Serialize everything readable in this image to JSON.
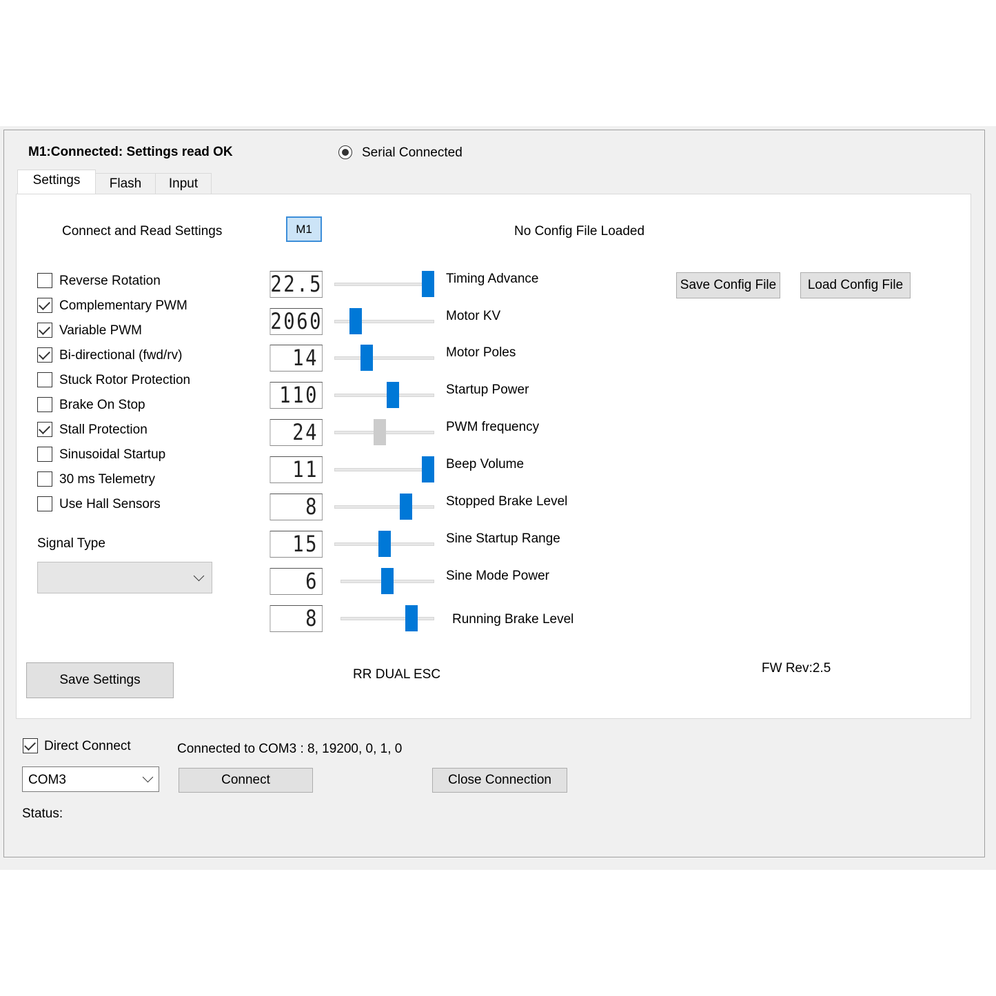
{
  "header": {
    "status_title": "M1:Connected: Settings read OK",
    "serial_radio_label": "Serial Connected"
  },
  "tabs": [
    {
      "label": "Settings",
      "active": true
    },
    {
      "label": "Flash",
      "active": false
    },
    {
      "label": "Input",
      "active": false
    }
  ],
  "settings": {
    "connect_read_label": "Connect and Read Settings",
    "m1_button": "M1",
    "config_status": "No Config File Loaded",
    "save_config_button": "Save Config File",
    "load_config_button": "Load Config File",
    "checkboxes": [
      {
        "label": "Reverse Rotation",
        "checked": false
      },
      {
        "label": "Complementary PWM",
        "checked": true
      },
      {
        "label": "Variable PWM",
        "checked": true
      },
      {
        "label": "Bi-directional (fwd/rv)",
        "checked": true
      },
      {
        "label": "Stuck Rotor Protection",
        "checked": false
      },
      {
        "label": "Brake On Stop",
        "checked": false
      },
      {
        "label": "Stall Protection",
        "checked": true
      },
      {
        "label": "Sinusoidal Startup",
        "checked": false
      },
      {
        "label": "30 ms Telemetry",
        "checked": false
      },
      {
        "label": "Use Hall Sensors",
        "checked": false
      }
    ],
    "signal_type_label": "Signal Type",
    "signal_type_value": "",
    "sliders": [
      {
        "label": "Timing Advance",
        "value": "22.5",
        "position": 1.0,
        "enabled": true
      },
      {
        "label": "Motor KV",
        "value": "2060",
        "position": 0.17,
        "enabled": true
      },
      {
        "label": "Motor Poles",
        "value": "14",
        "position": 0.3,
        "enabled": true
      },
      {
        "label": "Startup Power",
        "value": "110",
        "position": 0.6,
        "enabled": true
      },
      {
        "label": "PWM frequency",
        "value": "24",
        "position": 0.45,
        "enabled": false
      },
      {
        "label": "Beep Volume",
        "value": "11",
        "position": 1.0,
        "enabled": true
      },
      {
        "label": "Stopped Brake Level",
        "value": "8",
        "position": 0.75,
        "enabled": true
      },
      {
        "label": "Sine Startup Range",
        "value": "15",
        "position": 0.5,
        "enabled": true
      },
      {
        "label": "Sine Mode Power",
        "value": "6",
        "position": 0.5,
        "enabled": true
      },
      {
        "label": "Running Brake Level",
        "value": "8",
        "position": 0.8,
        "enabled": true
      }
    ],
    "save_settings_button": "Save Settings",
    "device_name": "RR DUAL ESC",
    "fw_rev": "FW Rev:2.5"
  },
  "connection": {
    "direct_connect_label": "Direct Connect",
    "direct_connect_checked": true,
    "connected_info": "Connected to COM3 : 8, 19200, 0, 1, 0",
    "port_value": "COM3",
    "connect_button": "Connect",
    "close_button": "Close Connection",
    "status_label": "Status:"
  }
}
